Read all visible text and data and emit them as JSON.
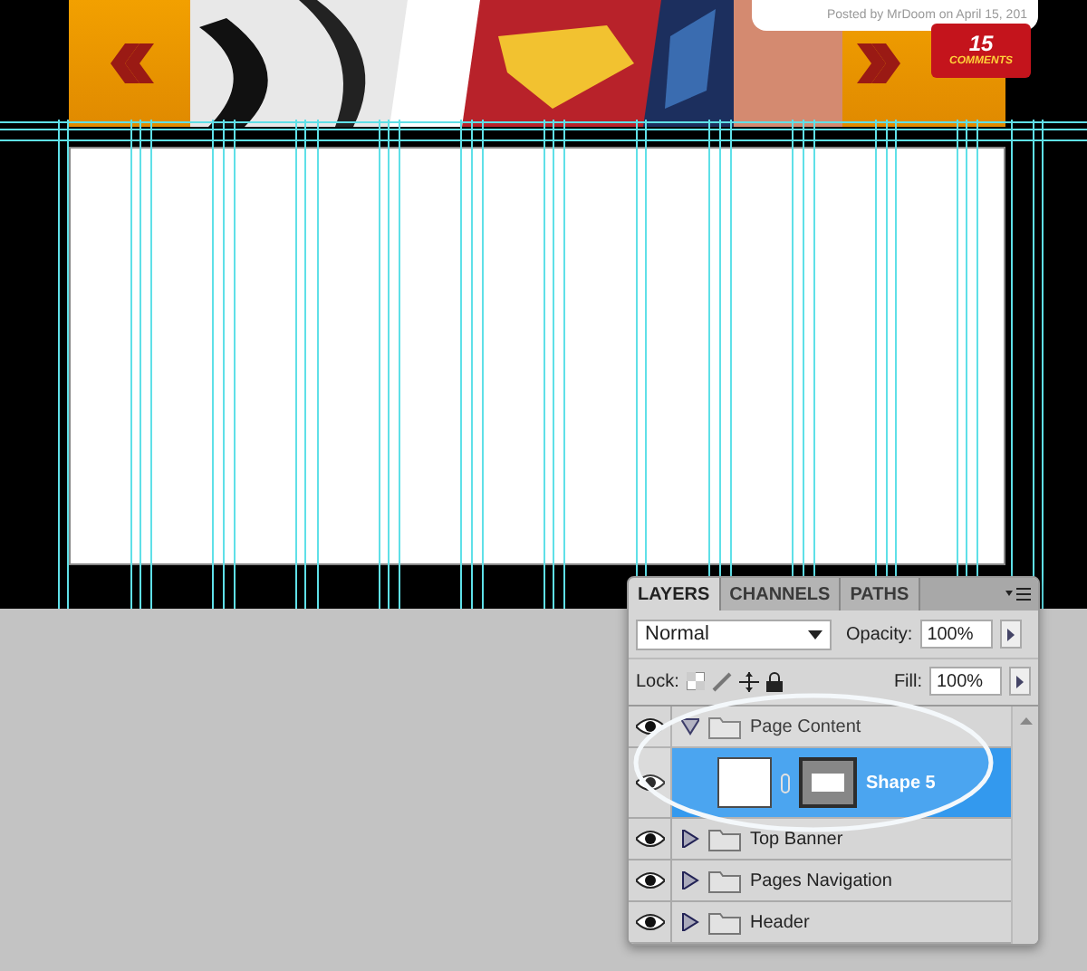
{
  "canvas": {
    "banner": {
      "post_meta": "Posted by MrDoom on April 15, 201",
      "comment_count": "15",
      "comment_label": "COMMENTS"
    }
  },
  "layers_panel": {
    "tabs": [
      {
        "label": "LAYERS",
        "selected": true
      },
      {
        "label": "CHANNELS",
        "selected": false
      },
      {
        "label": "PATHS",
        "selected": false
      }
    ],
    "blend_mode": "Normal",
    "opacity_label": "Opacity:",
    "opacity": "100%",
    "lock_label": "Lock:",
    "fill_label": "Fill:",
    "fill": "100%",
    "layers": [
      {
        "kind": "group",
        "name": "Page Content",
        "visible": true,
        "expanded": true,
        "selected": false,
        "children": [
          {
            "kind": "shape",
            "name": "Shape 5",
            "visible": true,
            "selected": true
          }
        ]
      },
      {
        "kind": "group",
        "name": "Top Banner",
        "visible": true,
        "expanded": false,
        "selected": false
      },
      {
        "kind": "group",
        "name": "Pages Navigation",
        "visible": true,
        "expanded": false,
        "selected": false
      },
      {
        "kind": "group",
        "name": "Header",
        "visible": true,
        "expanded": false,
        "selected": false
      }
    ]
  }
}
